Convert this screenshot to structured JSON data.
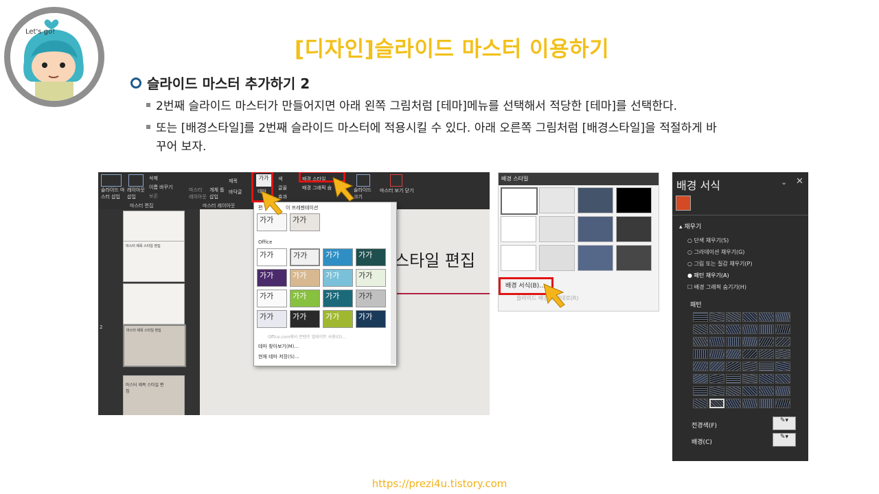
{
  "avatar": {
    "caption": "Let's go!"
  },
  "title": "[디자인]슬라이드 마스터 이용하기",
  "heading": "슬라이드 마스터 추가하기 2",
  "bullets": [
    "2번째 슬라이드 마스터가 만들어지면 아래 왼쪽 그림처럼 [테마]메뉴를 선택해서 적당한 [테마]를 선택한다.",
    "또는 [배경스타일]를 2번째 슬라이드 마스터에 적용시킬 수 있다. 아래 오른쪽 그림처럼 [배경스타일]을 적절하게 바",
    "꾸어 보자."
  ],
  "shot1": {
    "ribbon": {
      "insert_master": "슬라이드 마\n스터 삽입",
      "insert_layout": "레이아웃\n삽입",
      "delete": "삭제",
      "rename": "이름 바꾸기",
      "preserve": "보존",
      "group_edit": "마스터 편집",
      "master_layout": "마스터\n레이아웃",
      "insert_placeholder": "개체 틀\n삽입",
      "title_chk": "제목",
      "footer_chk": "바닥글",
      "group_layout": "마스터 레이아웃",
      "theme": "테마",
      "colors": "색",
      "fonts": "글꼴",
      "effects": "효과",
      "bg_styles": "배경 스타일",
      "hide_bg": "배경 그래픽 숨",
      "slide_size": "슬라이드\n크기",
      "close_master": "마스터 보기 닫기"
    },
    "gallery": {
      "sec_pres": "이 프레젠테이션",
      "sec_edit": "편",
      "sec_office": "Office",
      "theme_label": "가가",
      "browse": "테마 찾아보기(M)...",
      "save": "현재 테마 저장(S)...",
      "office_online": "Office.com에서 콘텐츠 업데이트 사용(O)..."
    },
    "canvas_title": "스타일 편집",
    "thumb_titles": [
      "마스터 제목 스타일 편집",
      "마스터 제목 스타일 편집",
      "마스터 제목 스타일 편\n집"
    ],
    "slide_num": "2"
  },
  "shot2": {
    "header": "배경 스타일",
    "format_bg": "배경 서식(B)...",
    "reset_bg": "슬라이드 배경 원래대로(R)"
  },
  "panel": {
    "title": "배경 서식",
    "section": "채우기",
    "options": [
      "단색 채우기(S)",
      "그라데이션 채우기(G)",
      "그림 또는 질감 채우기(P)",
      "패턴 채우기(A)"
    ],
    "hide_graphics": "배경 그래픽 숨기기(H)",
    "pattern_label": "패턴",
    "foreground": "전경색(F)",
    "background": "배경(C)"
  },
  "footer": "https://prezi4u.tistory.com",
  "colors": {
    "title": "#f2c01a",
    "accent_red": "#e01414",
    "arrow": "#f5b51a"
  }
}
